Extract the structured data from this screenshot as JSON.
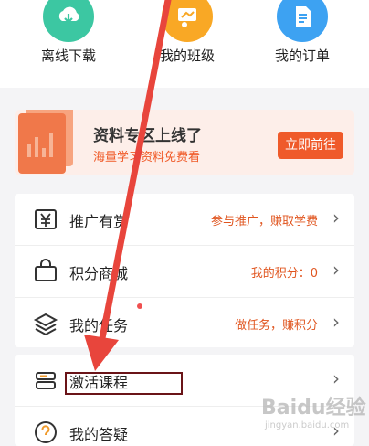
{
  "quick_actions": [
    {
      "label": "离线下载",
      "icon": "download-icon",
      "color": "#3cc7a2"
    },
    {
      "label": "我的班级",
      "icon": "class-board-icon",
      "color": "#f9a825"
    },
    {
      "label": "我的订单",
      "icon": "order-doc-icon",
      "color": "#3da2f2"
    }
  ],
  "banner": {
    "title": "资料专区上线了",
    "subtitle": "海量学习资料免费看",
    "button": "立即前往",
    "accent": "#ef5a2a"
  },
  "menu": [
    {
      "label": "推广有赏",
      "value": "参与推广，赚取学费",
      "icon": "yen-icon"
    },
    {
      "label": "积分商城",
      "value": "我的积分：0",
      "icon": "shop-bag-icon"
    },
    {
      "label": "我的任务",
      "value": "做任务，赚积分",
      "icon": "layers-icon",
      "badge_dot": true
    },
    {
      "label": "激活课程",
      "value": "",
      "icon": "book-stack-icon",
      "highlighted": true
    },
    {
      "label": "我的答疑",
      "value": "",
      "icon": "question-icon"
    }
  ],
  "chevron": "›",
  "watermark": {
    "logo": "Baidu经验",
    "sub": "jingyan.baidu.com"
  },
  "annotation": {
    "arrow_color": "#e8453c",
    "box_color": "#6a1418"
  }
}
